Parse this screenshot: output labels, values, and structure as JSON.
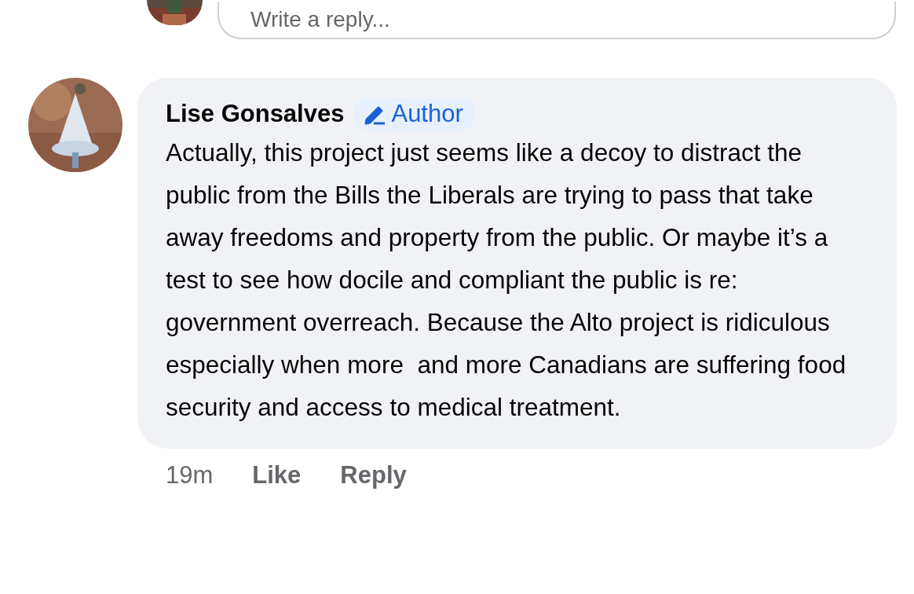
{
  "reply_field": {
    "placeholder": "Write a reply..."
  },
  "comment": {
    "author": "Lise Gonsalves",
    "badge": "Author",
    "text": "Actually, this project just seems like a decoy to distract the public from the Bills the Liberals are trying to pass that take away freedoms and property from the public. Or maybe it’s a test to see how docile and compliant the public is re: government overreach. Because the Alto project is ridiculous especially when more  and more Canadians are suffering food security and access to medical treatment.",
    "time": "19m",
    "actions": [
      "Like",
      "Reply"
    ]
  }
}
